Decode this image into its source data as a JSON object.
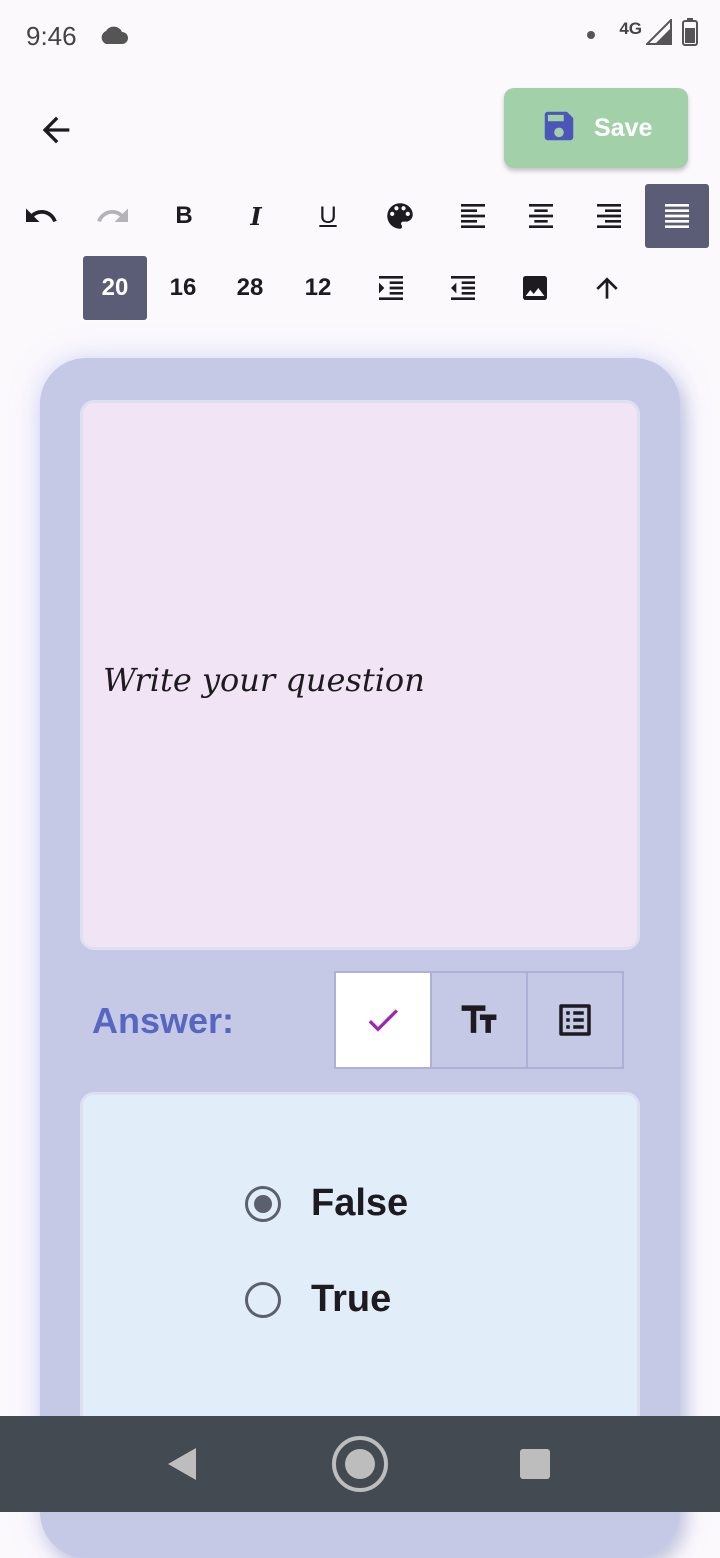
{
  "status_bar": {
    "time": "9:46",
    "network_label": "4G",
    "icons": [
      "cloud-icon",
      "notification-dot-icon",
      "signal-icon",
      "battery-icon"
    ]
  },
  "app_bar": {
    "back_icon": "arrow-back-icon",
    "save_label": "Save",
    "save_icon": "floppy-disk-icon",
    "save_button_color": "#a2d0a9"
  },
  "toolbar": {
    "row1": [
      "undo-icon",
      "redo-icon",
      "bold-icon",
      "italic-icon",
      "underline-icon",
      "palette-icon",
      "align-left-icon",
      "align-center-icon",
      "align-right-icon",
      "align-justify-icon"
    ],
    "row1_labels": {
      "bold": "B",
      "italic": "I",
      "underline": "U"
    },
    "active_alignment": "justify",
    "font_sizes": [
      "20",
      "16",
      "28",
      "12"
    ],
    "selected_font_size": "20",
    "row2_icons": [
      "indent-increase-icon",
      "indent-decrease-icon",
      "image-icon",
      "arrow-up-icon"
    ]
  },
  "question": {
    "placeholder": "Write your question"
  },
  "answer": {
    "label": "Answer:",
    "types": [
      "check-icon",
      "text-fields-icon",
      "list-icon"
    ],
    "selected_type": "true-false",
    "options": [
      {
        "label": "False",
        "selected": true
      },
      {
        "label": "True",
        "selected": false
      }
    ]
  },
  "nav_bar": {
    "buttons": [
      "back-triangle-icon",
      "home-circle-icon",
      "recents-square-icon"
    ]
  },
  "colors": {
    "accent": "#5666c1",
    "card": "#c5c9e6",
    "question_bg": "#f1e4f4",
    "options_bg": "#e1eef9",
    "active_toolbar": "#5a5d75",
    "check": "#9c27b0"
  }
}
